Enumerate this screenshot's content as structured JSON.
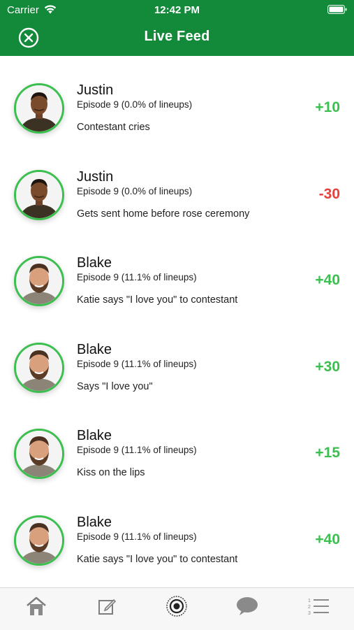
{
  "status_bar": {
    "carrier": "Carrier",
    "time": "12:42 PM"
  },
  "header": {
    "title": "Live Feed",
    "close_icon": "close-circle-icon"
  },
  "colors": {
    "brand_green": "#128a3a",
    "positive": "#3bbf4f",
    "negative": "#e8413c"
  },
  "feed": [
    {
      "name": "Justin",
      "episode": "Episode 9 (0.0% of lineups)",
      "event": "Contestant cries",
      "points": "+10",
      "sign": "pos",
      "avatar": "justin"
    },
    {
      "name": "Justin",
      "episode": "Episode 9 (0.0% of lineups)",
      "event": "Gets sent home before rose ceremony",
      "points": "-30",
      "sign": "neg",
      "avatar": "justin"
    },
    {
      "name": "Blake",
      "episode": "Episode 9 (11.1% of lineups)",
      "event": "Katie says \"I love you\" to contestant",
      "points": "+40",
      "sign": "pos",
      "avatar": "blake"
    },
    {
      "name": "Blake",
      "episode": "Episode 9 (11.1% of lineups)",
      "event": "Says \"I love you\"",
      "points": "+30",
      "sign": "pos",
      "avatar": "blake"
    },
    {
      "name": "Blake",
      "episode": "Episode 9 (11.1% of lineups)",
      "event": "Kiss on the lips",
      "points": "+15",
      "sign": "pos",
      "avatar": "blake"
    },
    {
      "name": "Blake",
      "episode": "Episode 9 (11.1% of lineups)",
      "event": "Katie says \"I love you\" to contestant",
      "points": "+40",
      "sign": "pos",
      "avatar": "blake"
    }
  ],
  "tab_bar": {
    "tabs": [
      "home-icon",
      "edit-icon",
      "live-feed-icon",
      "chat-icon",
      "rankings-list-icon"
    ]
  }
}
